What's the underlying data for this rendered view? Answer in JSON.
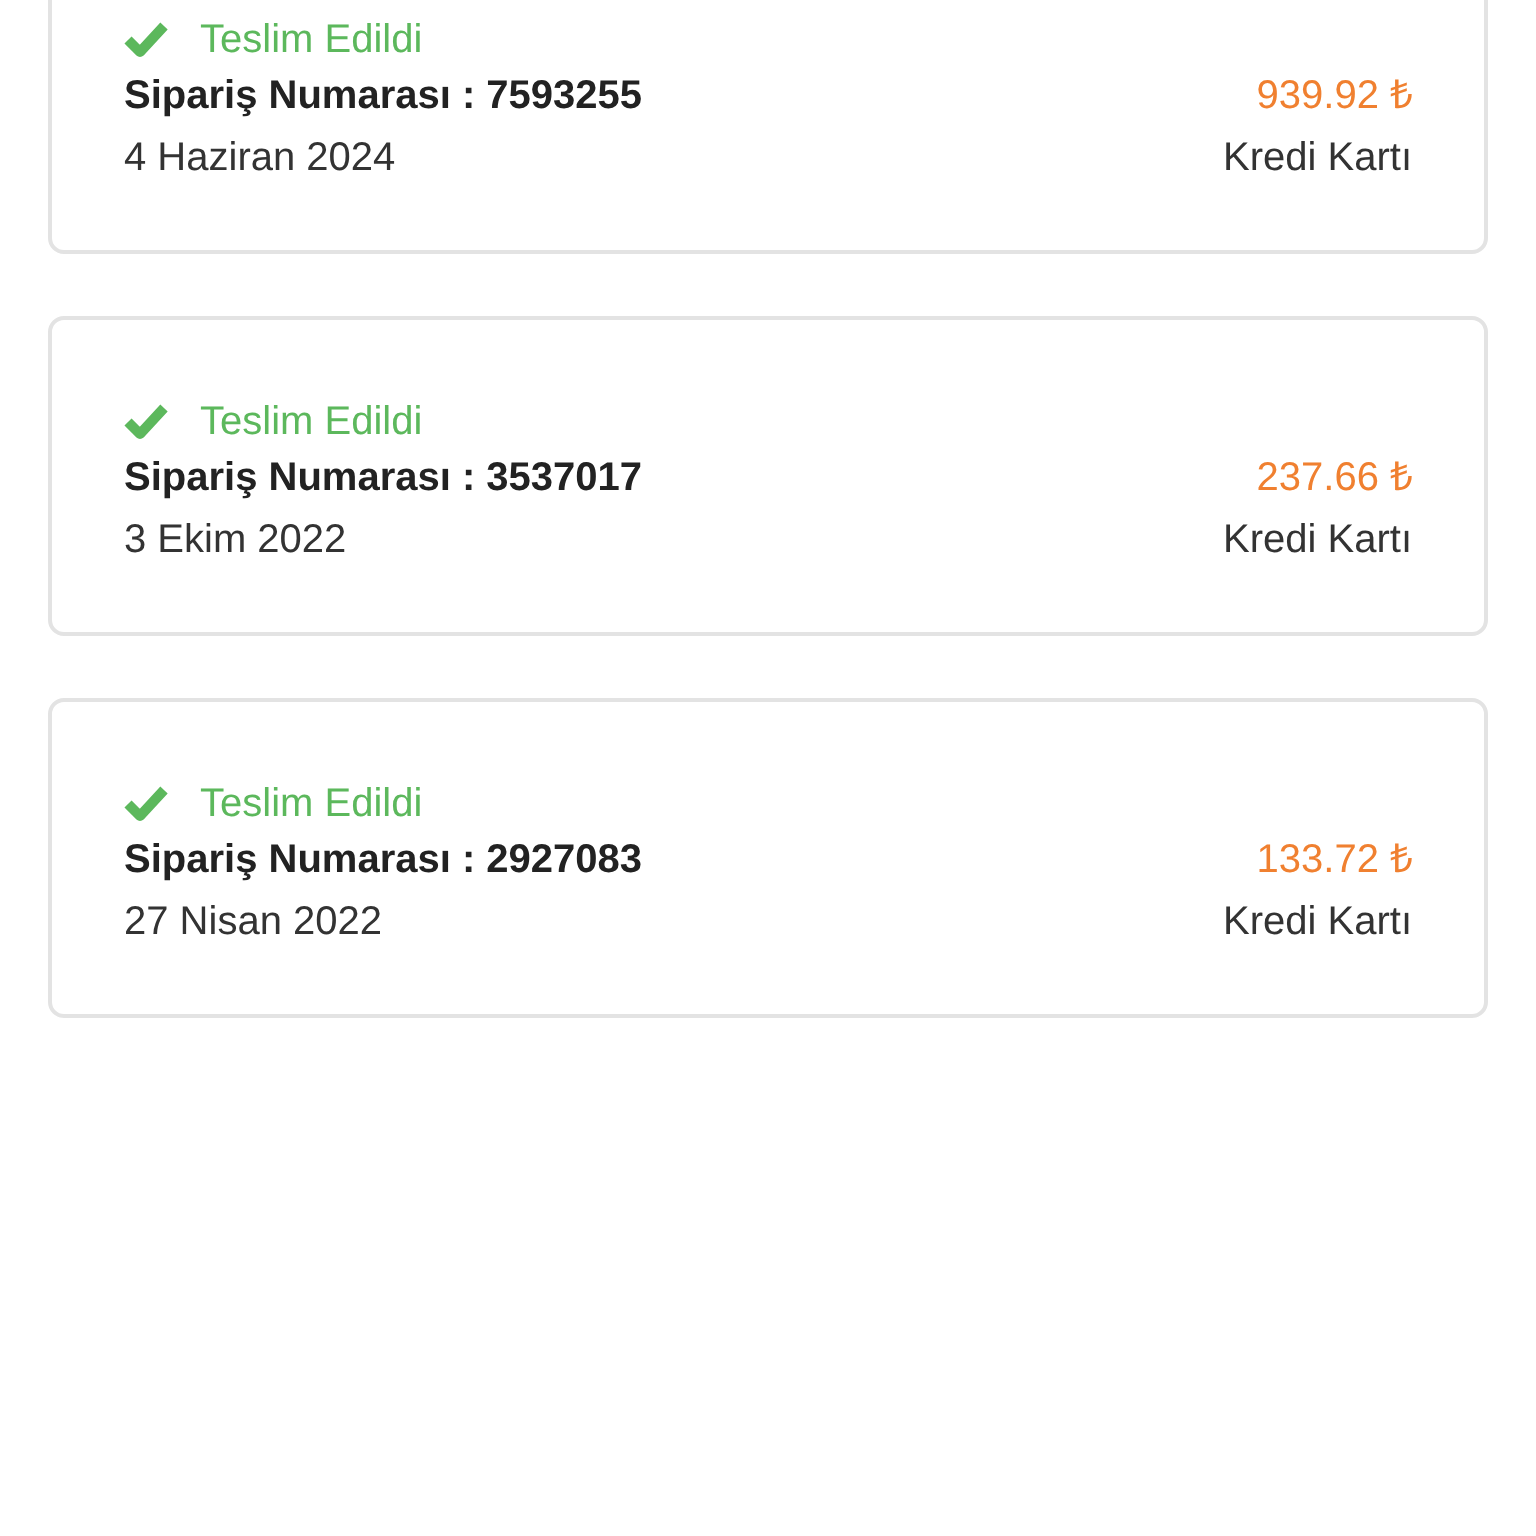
{
  "orders": [
    {
      "status": "Teslim Edildi",
      "delivered": true,
      "order_label": "Sipariş Numarası : 7593255",
      "date": "4 Haziran 2024",
      "price": "939.92 ₺",
      "payment": "Kredi Kartı"
    },
    {
      "status": "Teslim Edildi",
      "delivered": true,
      "order_label": "Sipariş Numarası : 3537017",
      "date": "3 Ekim 2022",
      "price": "237.66 ₺",
      "payment": "Kredi Kartı"
    },
    {
      "status": "Teslim Edildi",
      "delivered": true,
      "order_label": "Sipariş Numarası : 2927083",
      "date": "27 Nisan 2022",
      "price": "133.72 ₺",
      "payment": "Kredi Kartı"
    }
  ]
}
